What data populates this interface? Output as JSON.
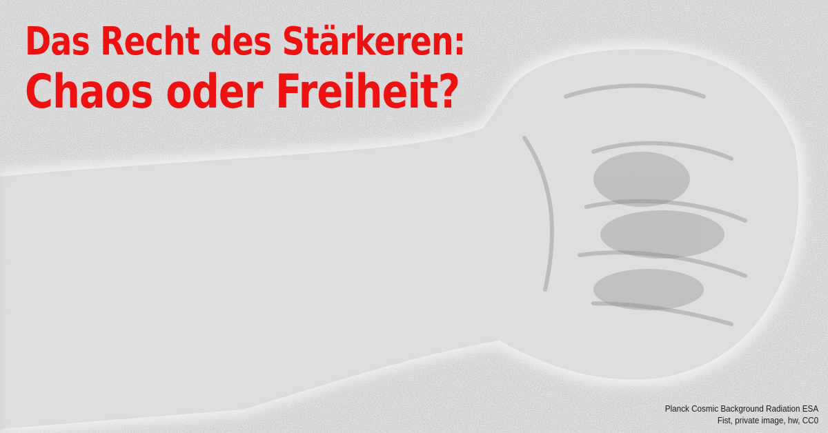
{
  "headline": {
    "line1": "Das Recht des Stärkeren:",
    "line2": "Chaos oder Freiheit?"
  },
  "credits": {
    "line1": "Planck Cosmic Background Radiation ESA",
    "line2": "Fist, private image, hw, CC0"
  },
  "colors": {
    "headline": "#ee1111",
    "credits": "#1a1a1a",
    "background": "#e9e9e9"
  },
  "image": {
    "subject": "fist-photo"
  }
}
